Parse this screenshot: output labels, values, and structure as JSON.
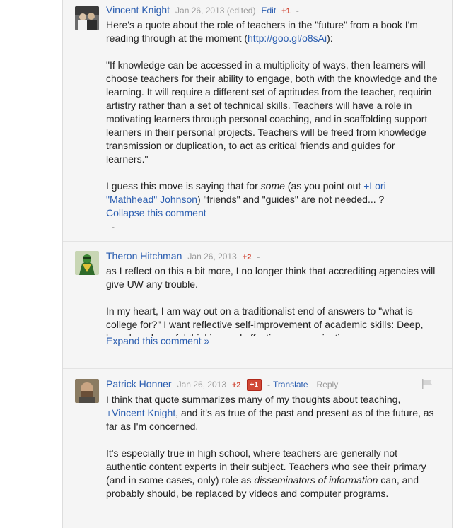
{
  "comments": [
    {
      "author": "Vincent Knight",
      "date": "Jan 26, 2013",
      "edited": "(edited)",
      "edit_label": "Edit",
      "plus": "+1",
      "dash": "-",
      "body_1_pre": "Here's a quote about the role of teachers in the \"future\" from a book I'm reading through at the moment (",
      "body_1_link": "http://goo.gl/o8sAi",
      "body_1_post": "):",
      "body_2": "\"If knowledge can be accessed in a multiplicity of ways, then learners will choose teachers for their ability to engage, both with the knowledge and the learning. It will require a different set of aptitudes from the teacher, requirin artistry rather than a set of technical skills. Teachers will have a role in motivating learners through personal coaching, and in scaffolding support learners in their personal projects. Teachers will be freed from knowledge transmission or duplication, to act as critical friends and guides for learners.\"",
      "body_3_pre": "I guess this move is saying that for ",
      "body_3_em": "some",
      "body_3_mid": " (as you point out ",
      "body_3_mention": "+Lori \"Mathhead\" Johnson",
      "body_3_post": ") \"friends\" and \"guides\" are not needed... ?",
      "collapse_label": "Collapse this comment",
      "after_dash": "-"
    },
    {
      "author": "Theron Hitchman",
      "date": "Jan 26, 2013",
      "plus": "+2",
      "dash": "-",
      "body_1": "as I reflect on this a bit more, I no longer think that accrediting agencies will give UW any trouble.",
      "body_2": "In my heart, I am way out on a traditionalist end of answers to \"what is college for?\" I want reflective self-improvement of academic skills: Deep, broad, and careful thinking and effective communication.",
      "expand_label": "Expand this comment »"
    },
    {
      "author": "Patrick Honner",
      "date": "Jan 26, 2013",
      "plus": "+2",
      "plus_button": "+1",
      "dash": "-",
      "translate_label": "Translate",
      "reply_label": "Reply",
      "body_1_pre": "I think that quote summarizes many of my thoughts about teaching, ",
      "body_1_mention": "+Vincent Knight",
      "body_1_post": ", and it's as true of the past and present as of the future, as far as I'm concerned.",
      "body_2_pre": "It's especially true in high school, where teachers are generally not authentic content experts in their subject.  Teachers who see their primary (and in some cases, only) role as ",
      "body_2_em": "disseminators of information",
      "body_2_post": " can, and probably should, be replaced by videos and computer programs."
    }
  ]
}
